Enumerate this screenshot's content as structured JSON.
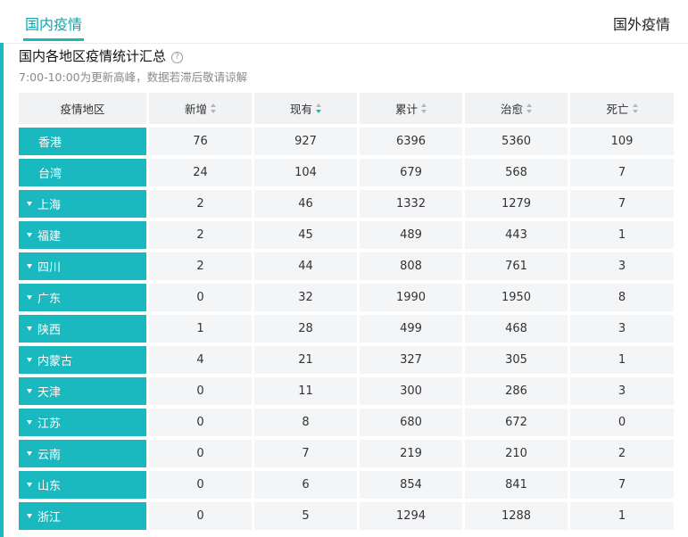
{
  "tabs": {
    "domestic": "国内疫情",
    "foreign": "国外疫情"
  },
  "header": {
    "title": "国内各地区疫情统计汇总",
    "help_icon": "?",
    "subtitle": "7:00-10:00为更新高峰，数据若滞后敬请谅解"
  },
  "table": {
    "columns": [
      "疫情地区",
      "新增",
      "现有",
      "累计",
      "治愈",
      "死亡"
    ],
    "sorted_column": "现有",
    "rows": [
      {
        "region": "香港",
        "expandable": false,
        "new": "76",
        "current": "927",
        "total": "6396",
        "cured": "5360",
        "dead": "109"
      },
      {
        "region": "台湾",
        "expandable": false,
        "new": "24",
        "current": "104",
        "total": "679",
        "cured": "568",
        "dead": "7"
      },
      {
        "region": "上海",
        "expandable": true,
        "new": "2",
        "current": "46",
        "total": "1332",
        "cured": "1279",
        "dead": "7"
      },
      {
        "region": "福建",
        "expandable": true,
        "new": "2",
        "current": "45",
        "total": "489",
        "cured": "443",
        "dead": "1"
      },
      {
        "region": "四川",
        "expandable": true,
        "new": "2",
        "current": "44",
        "total": "808",
        "cured": "761",
        "dead": "3"
      },
      {
        "region": "广东",
        "expandable": true,
        "new": "0",
        "current": "32",
        "total": "1990",
        "cured": "1950",
        "dead": "8"
      },
      {
        "region": "陕西",
        "expandable": true,
        "new": "1",
        "current": "28",
        "total": "499",
        "cured": "468",
        "dead": "3"
      },
      {
        "region": "内蒙古",
        "expandable": true,
        "new": "4",
        "current": "21",
        "total": "327",
        "cured": "305",
        "dead": "1"
      },
      {
        "region": "天津",
        "expandable": true,
        "new": "0",
        "current": "11",
        "total": "300",
        "cured": "286",
        "dead": "3"
      },
      {
        "region": "江苏",
        "expandable": true,
        "new": "0",
        "current": "8",
        "total": "680",
        "cured": "672",
        "dead": "0"
      },
      {
        "region": "云南",
        "expandable": true,
        "new": "0",
        "current": "7",
        "total": "219",
        "cured": "210",
        "dead": "2"
      },
      {
        "region": "山东",
        "expandable": true,
        "new": "0",
        "current": "6",
        "total": "854",
        "cured": "841",
        "dead": "7"
      },
      {
        "region": "浙江",
        "expandable": true,
        "new": "0",
        "current": "5",
        "total": "1294",
        "cured": "1288",
        "dead": "1"
      }
    ]
  },
  "colors": {
    "accent": "#1ab8bf",
    "cell_bg": "#f4f5f7",
    "header_bg": "#f0f2f4"
  }
}
